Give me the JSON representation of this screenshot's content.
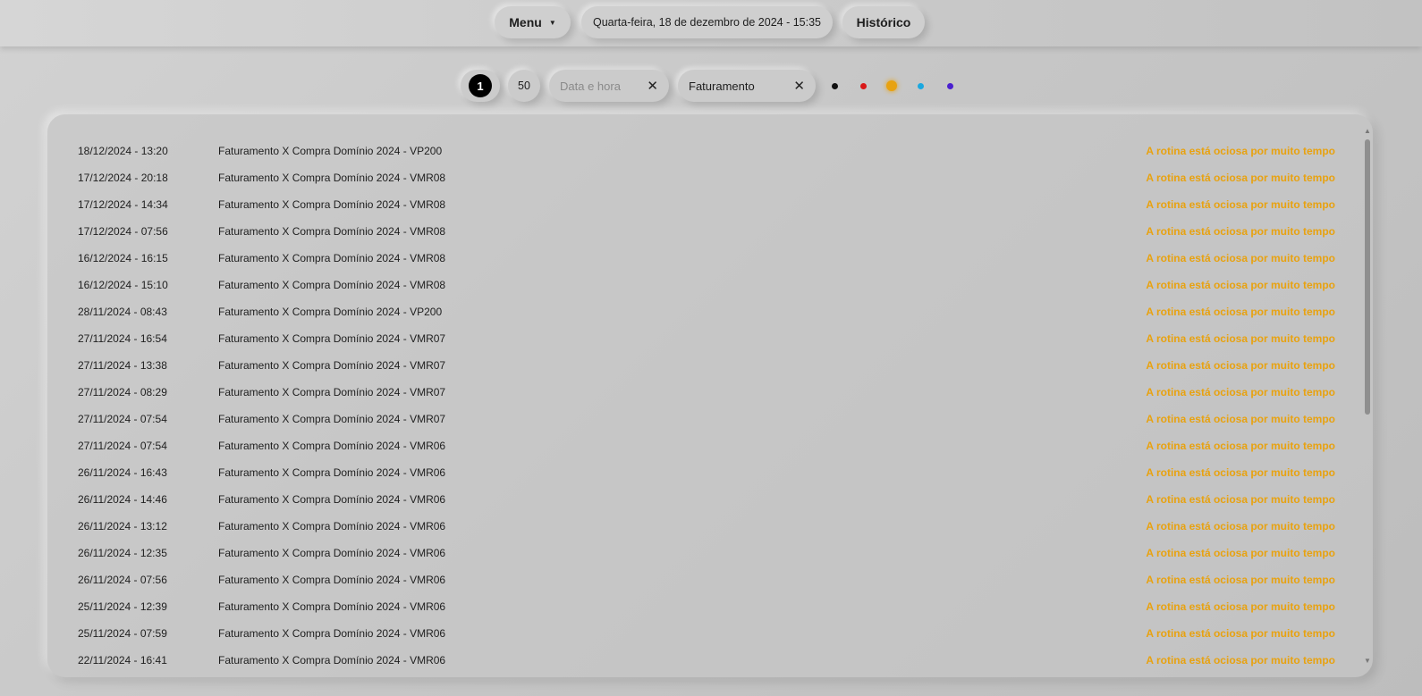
{
  "header": {
    "menu_label": "Menu",
    "datetime": "Quarta-feira, 18 de dezembro de 2024 - 15:35",
    "history_label": "Histórico"
  },
  "filters": {
    "page": "1",
    "count": "50",
    "date_placeholder": "Data e hora",
    "category_value": "Faturamento",
    "status_colors": [
      {
        "name": "black",
        "color": "#111111"
      },
      {
        "name": "red",
        "color": "#d91818"
      },
      {
        "name": "orange",
        "color": "#e8a210",
        "selected": true
      },
      {
        "name": "cyan",
        "color": "#1aa8e0"
      },
      {
        "name": "purple",
        "color": "#4a1fd0"
      }
    ]
  },
  "rows": [
    {
      "date": "18/12/2024 - 13:20",
      "name": "Faturamento X Compra Domínio 2024 - VP200",
      "status": "A rotina está ociosa por muito tempo"
    },
    {
      "date": "17/12/2024 - 20:18",
      "name": "Faturamento X Compra Domínio 2024 - VMR08",
      "status": "A rotina está ociosa por muito tempo"
    },
    {
      "date": "17/12/2024 - 14:34",
      "name": "Faturamento X Compra Domínio 2024 - VMR08",
      "status": "A rotina está ociosa por muito tempo"
    },
    {
      "date": "17/12/2024 - 07:56",
      "name": "Faturamento X Compra Domínio 2024 - VMR08",
      "status": "A rotina está ociosa por muito tempo"
    },
    {
      "date": "16/12/2024 - 16:15",
      "name": "Faturamento X Compra Domínio 2024 - VMR08",
      "status": "A rotina está ociosa por muito tempo"
    },
    {
      "date": "16/12/2024 - 15:10",
      "name": "Faturamento X Compra Domínio 2024 - VMR08",
      "status": "A rotina está ociosa por muito tempo"
    },
    {
      "date": "28/11/2024 - 08:43",
      "name": "Faturamento X Compra Domínio 2024 - VP200",
      "status": "A rotina está ociosa por muito tempo"
    },
    {
      "date": "27/11/2024 - 16:54",
      "name": "Faturamento X Compra Domínio 2024 - VMR07",
      "status": "A rotina está ociosa por muito tempo"
    },
    {
      "date": "27/11/2024 - 13:38",
      "name": "Faturamento X Compra Domínio 2024 - VMR07",
      "status": "A rotina está ociosa por muito tempo"
    },
    {
      "date": "27/11/2024 - 08:29",
      "name": "Faturamento X Compra Domínio 2024 - VMR07",
      "status": "A rotina está ociosa por muito tempo"
    },
    {
      "date": "27/11/2024 - 07:54",
      "name": "Faturamento X Compra Domínio 2024 - VMR07",
      "status": "A rotina está ociosa por muito tempo"
    },
    {
      "date": "27/11/2024 - 07:54",
      "name": "Faturamento X Compra Domínio 2024 - VMR06",
      "status": "A rotina está ociosa por muito tempo"
    },
    {
      "date": "26/11/2024 - 16:43",
      "name": "Faturamento X Compra Domínio 2024 - VMR06",
      "status": "A rotina está ociosa por muito tempo"
    },
    {
      "date": "26/11/2024 - 14:46",
      "name": "Faturamento X Compra Domínio 2024 - VMR06",
      "status": "A rotina está ociosa por muito tempo"
    },
    {
      "date": "26/11/2024 - 13:12",
      "name": "Faturamento X Compra Domínio 2024 - VMR06",
      "status": "A rotina está ociosa por muito tempo"
    },
    {
      "date": "26/11/2024 - 12:35",
      "name": "Faturamento X Compra Domínio 2024 - VMR06",
      "status": "A rotina está ociosa por muito tempo"
    },
    {
      "date": "26/11/2024 - 07:56",
      "name": "Faturamento X Compra Domínio 2024 - VMR06",
      "status": "A rotina está ociosa por muito tempo"
    },
    {
      "date": "25/11/2024 - 12:39",
      "name": "Faturamento X Compra Domínio 2024 - VMR06",
      "status": "A rotina está ociosa por muito tempo"
    },
    {
      "date": "25/11/2024 - 07:59",
      "name": "Faturamento X Compra Domínio 2024 - VMR06",
      "status": "A rotina está ociosa por muito tempo"
    },
    {
      "date": "22/11/2024 - 16:41",
      "name": "Faturamento X Compra Domínio 2024 - VMR06",
      "status": "A rotina está ociosa por muito tempo"
    }
  ]
}
